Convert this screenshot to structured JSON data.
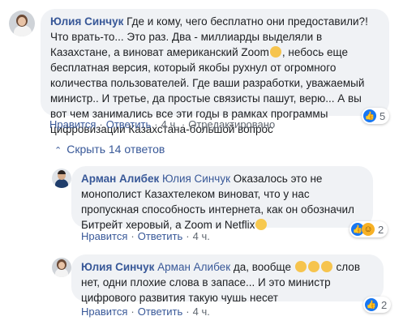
{
  "comments": [
    {
      "author": "Юлия Синчук",
      "text": "Где и кому, чего бесплатно они предоставили?! Что врать-то... Это раз. Два - миллиарды выделяли в Казахстане, а виноват американский Zoom",
      "text2": ", небось еще бесплатная версия, который якобы рухнул от огромного количества пользователей. Где ваши разработки, уважаемый министр.. И третье, да простые связисты пашут, верю... А вы вот чем занимались все эти годы в рамках программы цифровизации Казахстана-большой вопрос",
      "reaction_count": "5",
      "actions": {
        "like": "Нравится",
        "reply": "Ответить",
        "time": "4 ч.",
        "edited": "Отредактировано"
      }
    }
  ],
  "toggle_replies": "Скрыть 14 ответов",
  "replies": [
    {
      "author": "Арман Алибек",
      "mention": "Юлия Синчук",
      "text": "Оказалось это не монополист Казахтелеком виноват, что у нас пропускная способность интернета, как он обозначил Битрейт херовый, а Zoom и Netflix",
      "reaction_count": "2",
      "actions": {
        "like": "Нравится",
        "reply": "Ответить",
        "time": "4 ч."
      }
    },
    {
      "author": "Юлия Синчук",
      "mention": "Арман Алибек",
      "text": "да, вообще",
      "text2": "слов нет, одни плохие слова в запасе... И это министр цифрового развития такую чушь несет",
      "reaction_count": "2",
      "actions": {
        "like": "Нравится",
        "reply": "Ответить",
        "time": "4 ч."
      }
    }
  ],
  "icons": {
    "like": "thumbs-up-icon",
    "haha": "laughing-face-icon",
    "toggle": "chevron-up-icon"
  },
  "colors": {
    "link": "#385898",
    "bubble": "#f0f2f5",
    "like": "#1877f2"
  }
}
